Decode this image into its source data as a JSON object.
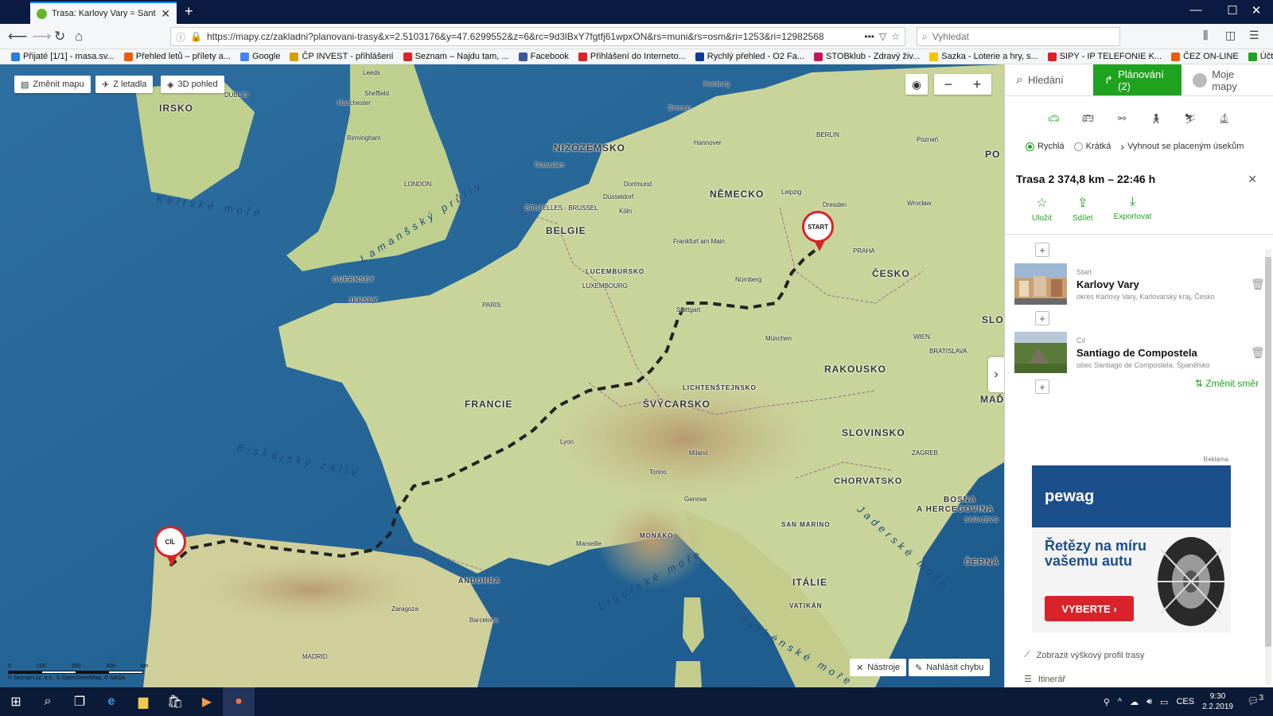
{
  "browser": {
    "tab_title": "Trasa: Karlovy Vary = Santiago",
    "url": "https://mapy.cz/zakladni?planovani-trasy&x=2.5103176&y=47.6299552&z=6&rc=9d3lBxY7fgtfj61wpxON&rs=muni&rs=osm&ri=1253&ri=12982568",
    "search_placeholder": "Vyhledat",
    "bookmarks": [
      {
        "label": "Přijaté [1/1] - masa.sv...",
        "color": "#2a7fd4"
      },
      {
        "label": "Přehled letů – přílety a...",
        "color": "#e85c0d"
      },
      {
        "label": "Google",
        "color": "#4285f4"
      },
      {
        "label": "ČP INVEST - přihlášení",
        "color": "#d4a000"
      },
      {
        "label": "Seznam – Najdu tam, ...",
        "color": "#d8232a"
      },
      {
        "label": "Facebook",
        "color": "#3b5998"
      },
      {
        "label": "Přihlášení do Interneto...",
        "color": "#d8232a"
      },
      {
        "label": "Rychlý přehled - O2 Fa...",
        "color": "#0b3d91"
      },
      {
        "label": "STOBklub - Zdravý živ...",
        "color": "#c2185b"
      },
      {
        "label": "Sazka - Loterie a hry, s...",
        "color": "#f5c400"
      },
      {
        "label": "SIPY - IP TELEFONIE K...",
        "color": "#d8232a"
      },
      {
        "label": "ČEZ ON-LINE",
        "color": "#e85c0d"
      },
      {
        "label": "Účtenková loterie",
        "color": "#1fa31f"
      }
    ]
  },
  "map": {
    "buttons": {
      "change_map": "Změnit mapu",
      "aerial": "Z letadla",
      "view3d": "3D pohled"
    },
    "countries": [
      {
        "id": "irsko",
        "label": "IRSKO"
      },
      {
        "id": "nizozemsko",
        "label": "NIZOZEMSKO"
      },
      {
        "id": "nemecko",
        "label": "NĚMECKO"
      },
      {
        "id": "belgie",
        "label": "BELGIE"
      },
      {
        "id": "lucembursko",
        "label": "LUCEMBURSKO"
      },
      {
        "id": "cesko",
        "label": "ČESKO"
      },
      {
        "id": "francie",
        "label": "FRANCIE"
      },
      {
        "id": "svycarsko",
        "label": "ŠVÝCARSKO"
      },
      {
        "id": "lichtenstejnsko",
        "label": "LICHTENŠTEJNSKO"
      },
      {
        "id": "rakousko",
        "label": "RAKOUSKO"
      },
      {
        "id": "slovinsko",
        "label": "SLOVINSKO"
      },
      {
        "id": "chorvatsko",
        "label": "CHORVATSKO"
      },
      {
        "id": "bosna",
        "label": "BOSNA"
      },
      {
        "id": "hercegovina",
        "label": "A HERCEGOVINA"
      },
      {
        "id": "sanmarino",
        "label": "SAN MARINO"
      },
      {
        "id": "monako",
        "label": "MONAKO"
      },
      {
        "id": "andorra",
        "label": "ANDORRA"
      },
      {
        "id": "italie",
        "label": "ITÁLIE"
      },
      {
        "id": "vatikan",
        "label": "VATIKÁN"
      },
      {
        "id": "cerna",
        "label": "ČERNÁ"
      },
      {
        "id": "slo",
        "label": "SLO"
      },
      {
        "id": "mad",
        "label": "MAĎ"
      },
      {
        "id": "po",
        "label": "PO"
      },
      {
        "id": "guernsey",
        "label": "GUERNSEY"
      },
      {
        "id": "jersey",
        "label": "JERSEY"
      }
    ],
    "cities": [
      "Leeds",
      "DUBLIN",
      "Sheffield",
      "Manchester",
      "Birmingham",
      "LONDON",
      "Hamburg",
      "Bremen",
      "Hannover",
      "BERLIN",
      "Poznań",
      "Rotterdam",
      "Dortmund",
      "Düsseldorf",
      "Köln",
      "BRUXELLES - BRUSSEL",
      "Leipzig",
      "Dresden",
      "Wrocław",
      "Frankfurt am Main",
      "PRAHA",
      "LUXEMBOURG",
      "Nürnberg",
      "PARIS",
      "Stuttgart",
      "München",
      "WIEN",
      "BRATISLAVA",
      "Lyon",
      "Milano",
      "ZAGREB",
      "Torino",
      "Genova",
      "SARAJEVO",
      "Marseille",
      "Zaragoza",
      "Barcelona",
      "MADRID"
    ],
    "seas": [
      "Keltské moře",
      "Lamanšský průliv",
      "Biskajský záliv",
      "Ligurské moře",
      "Jaderské moře",
      "Tyrhénské moře"
    ],
    "pins": {
      "start": "START",
      "end": "CÍL"
    },
    "tools": {
      "tools": "Nástroje",
      "report": "Nahlásit chybu"
    },
    "scale": {
      "labels": [
        "0",
        "100",
        "200",
        "300"
      ],
      "unit": "km"
    },
    "attribution": "© Seznam.cz, a.s., © OpenStreetMap, © NASA"
  },
  "sidebar": {
    "tabs": {
      "search": "Hledání",
      "planning": "Plánování (2)",
      "mymaps": "Moje mapy"
    },
    "route_options": {
      "fast": "Rychlá",
      "short": "Krátká",
      "avoid": "Vyhnout se placeným úsekům"
    },
    "route_title": "Trasa 2 374,8 km – 22:46 h",
    "actions": {
      "save": "Uložit",
      "share": "Sdílet",
      "export": "Exportovat"
    },
    "waypoints": [
      {
        "label": "Start",
        "name": "Karlovy Vary",
        "desc": "okres Karlovy Vary, Karlovarský kraj, Česko"
      },
      {
        "label": "Cíl",
        "name": "Santiago de Compostela",
        "desc": "obec Santiago de Compostela, Španělsko"
      }
    ],
    "swap": "Změnit směr",
    "ad": {
      "label": "Reklama",
      "brand": "pewag",
      "text": "Řetězy na míru vašemu autu",
      "button": "VYBERTE"
    },
    "elevation": "Zobrazit výškový profil trasy",
    "itinerary": "Itinerář"
  },
  "taskbar": {
    "lang": "CES",
    "time": "9:30",
    "date": "2.2.2019",
    "notifications": "3"
  }
}
